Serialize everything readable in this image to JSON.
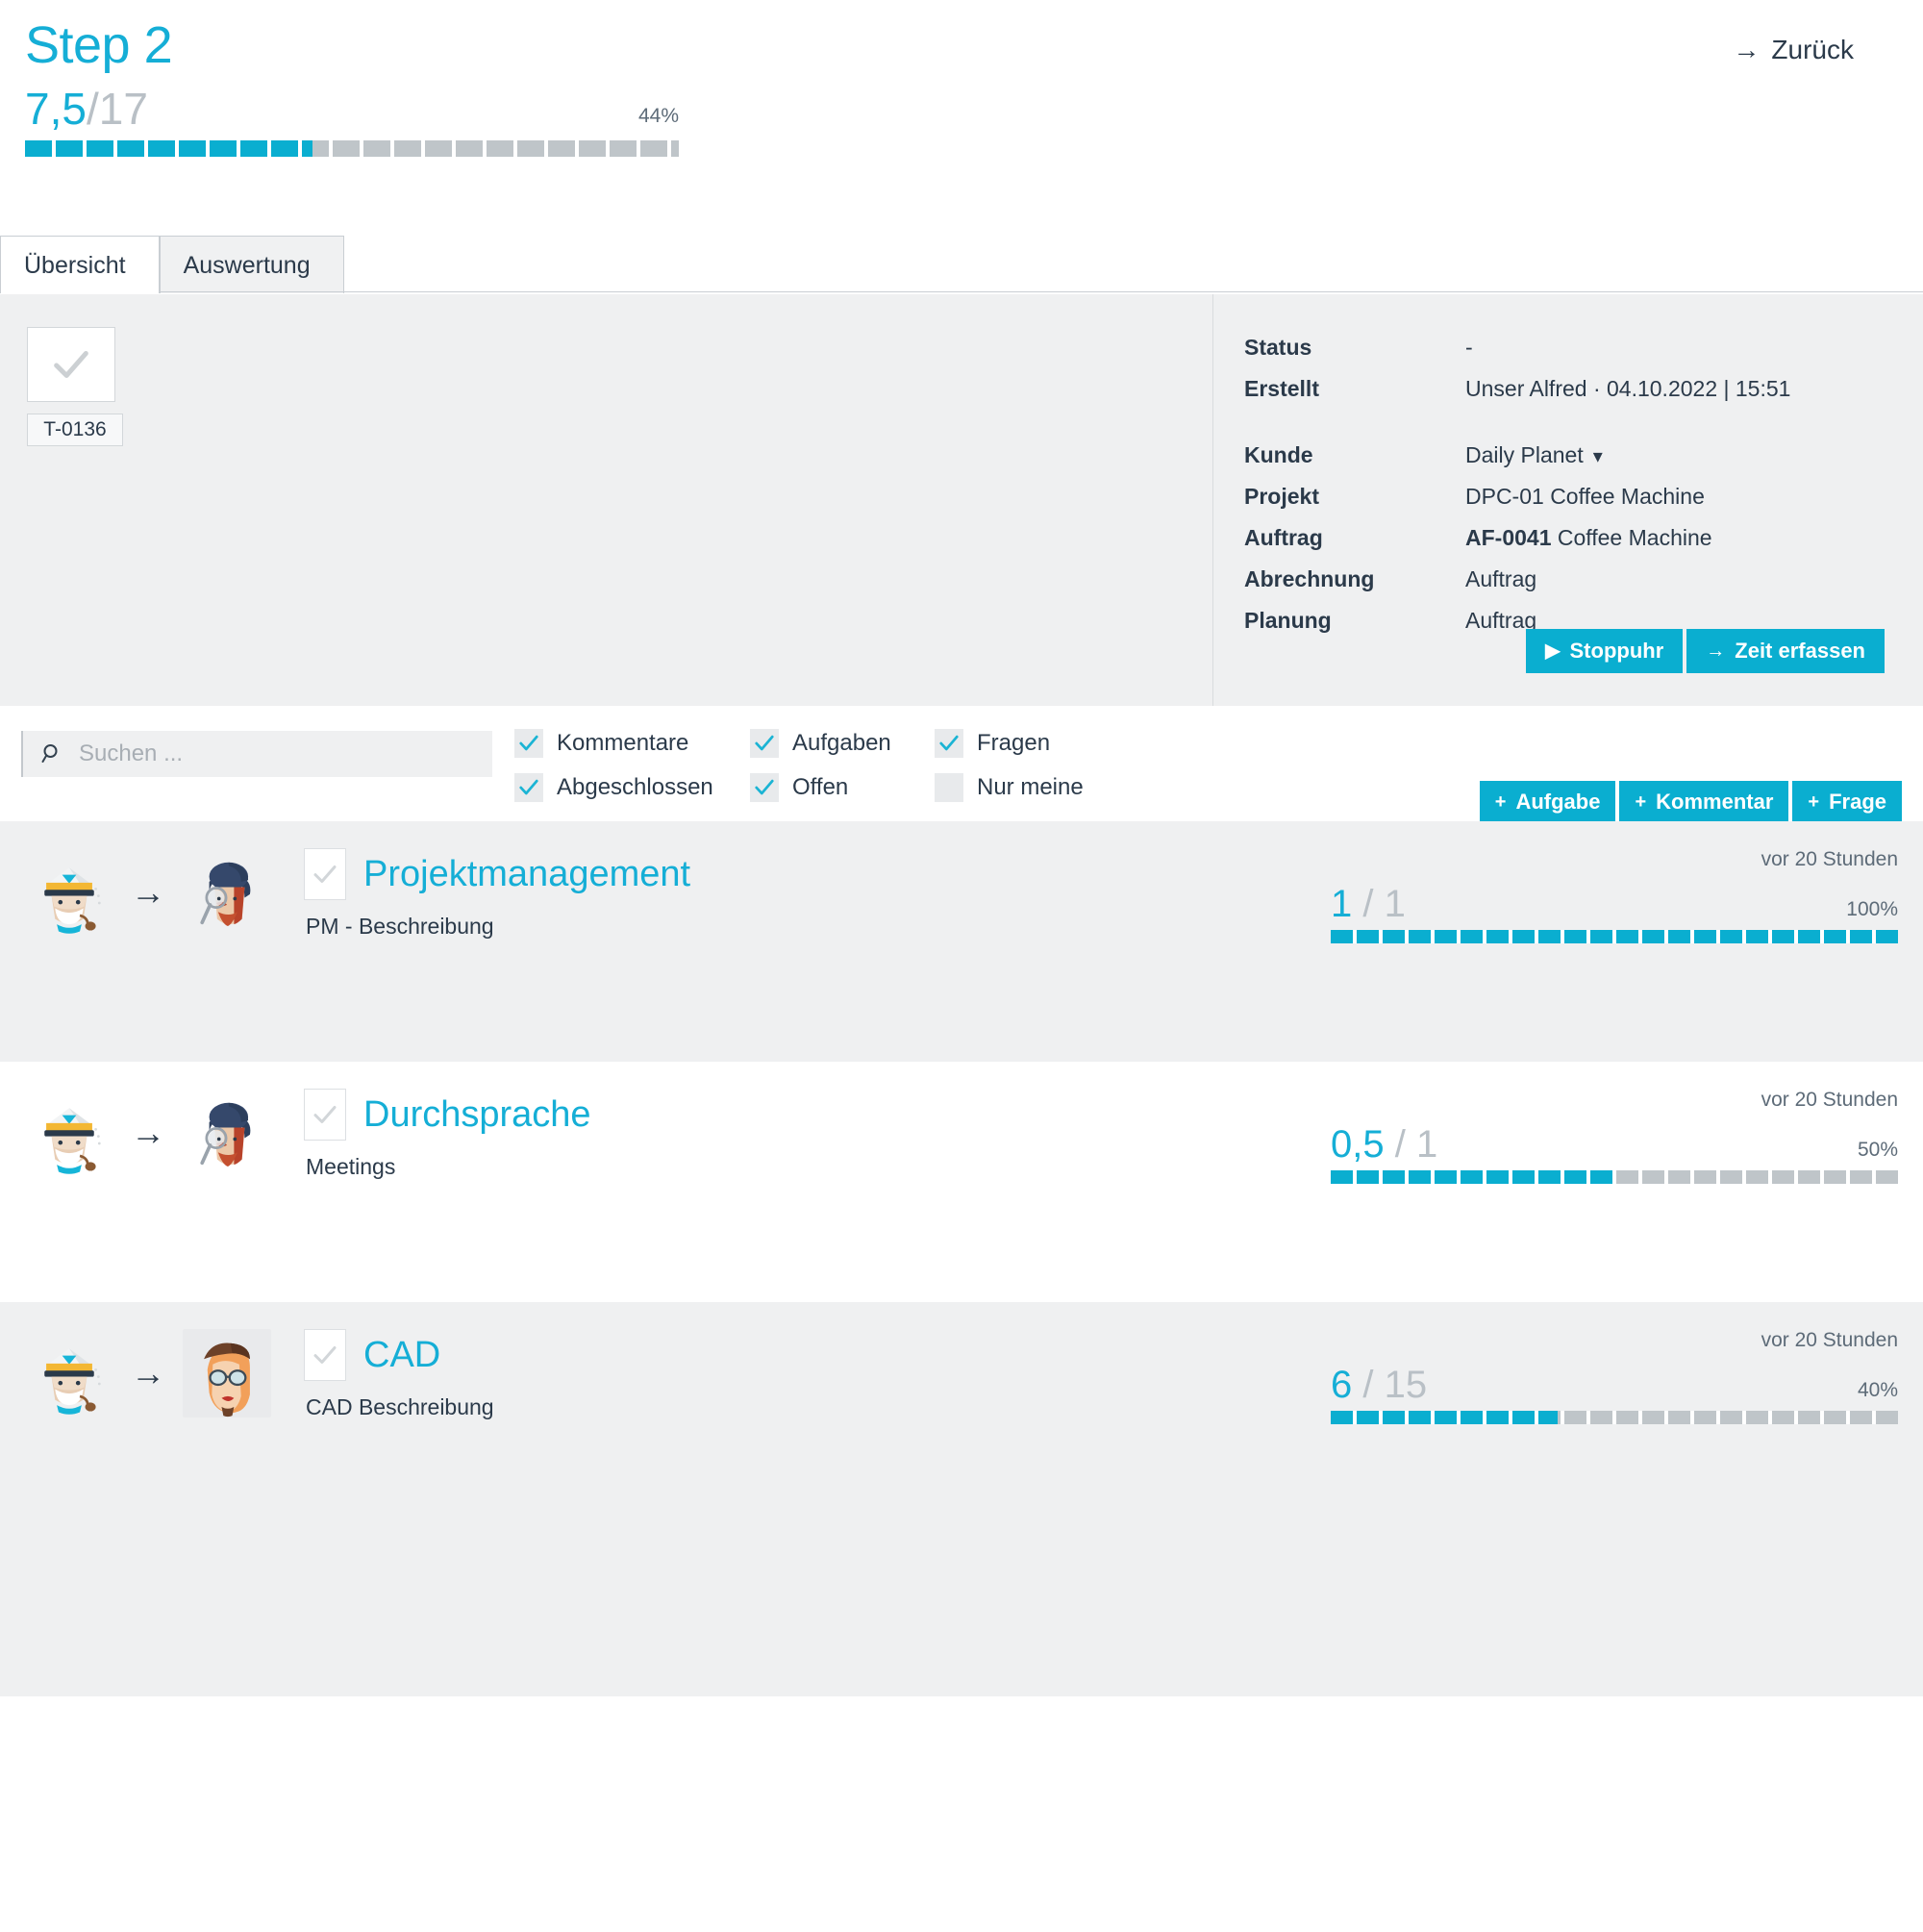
{
  "header": {
    "step_title": "Step 2",
    "back_label": "Zurück",
    "back_icon": "arrow-right-icon",
    "progress": {
      "current": "7,5",
      "separator": "/",
      "total": "17",
      "percent_label": "44%",
      "percent_value": 44
    }
  },
  "tabs": [
    {
      "label": "Übersicht",
      "active": true
    },
    {
      "label": "Auswertung",
      "active": false
    }
  ],
  "detail": {
    "task_badge": "T-0136",
    "check_icon": "check-icon",
    "meta": [
      {
        "label": "Status",
        "value": "-"
      },
      {
        "label": "Erstellt",
        "value": "Unser Alfred · 04.10.2022 | 15:51"
      },
      {
        "label": "Kunde",
        "value": "Daily Planet",
        "dropdown": true
      },
      {
        "label": "Projekt",
        "value": "DPC-01 Coffee Machine"
      },
      {
        "label": "Auftrag",
        "value_bold": "AF-0041",
        "value": "Coffee Machine"
      },
      {
        "label": "Abrechnung",
        "value": "Auftrag"
      },
      {
        "label": "Planung",
        "value": "Auftrag"
      }
    ],
    "actions": [
      {
        "label": "Stoppuhr",
        "icon": "play-icon",
        "glyph": "▶"
      },
      {
        "label": "Zeit erfassen",
        "icon": "arrow-right-icon",
        "glyph": "→"
      }
    ]
  },
  "filters": {
    "search_placeholder": "Suchen ...",
    "search_value": "",
    "search_icon": "search-icon",
    "checkboxes": [
      {
        "label": "Kommentare",
        "checked": true
      },
      {
        "label": "Aufgaben",
        "checked": true
      },
      {
        "label": "Fragen",
        "checked": true
      },
      {
        "label": "Abgeschlossen",
        "checked": true
      },
      {
        "label": "Offen",
        "checked": true
      },
      {
        "label": "Nur meine",
        "checked": false
      }
    ],
    "add_buttons": [
      {
        "label": "Aufgabe",
        "icon": "plus-icon",
        "glyph": "+"
      },
      {
        "label": "Kommentar",
        "icon": "plus-icon",
        "glyph": "+"
      },
      {
        "label": "Frage",
        "icon": "plus-icon",
        "glyph": "+"
      }
    ]
  },
  "task_rows": [
    {
      "title": "Projektmanagement",
      "description": "PM - Beschreibung",
      "time": "vor 20 Stunden",
      "current": "1",
      "separator": "/",
      "total": "1",
      "percent_label": "100%",
      "percent_value": 100,
      "from_avatar": "captain-avatar",
      "to_avatar": "detective-avatar",
      "check_icon": "check-icon"
    },
    {
      "title": "Durchsprache",
      "description": "Meetings",
      "time": "vor 20 Stunden",
      "current": "0,5",
      "separator": "/",
      "total": "1",
      "percent_label": "50%",
      "percent_value": 50,
      "from_avatar": "captain-avatar",
      "to_avatar": "detective-avatar",
      "check_icon": "check-icon"
    },
    {
      "title": "CAD",
      "description": "CAD Beschreibung",
      "time": "vor 20 Stunden",
      "current": "6",
      "separator": "/",
      "total": "15",
      "percent_label": "40%",
      "percent_value": 40,
      "from_avatar": "captain-avatar",
      "to_avatar": "designer-avatar",
      "check_icon": "check-icon"
    }
  ],
  "colors": {
    "accent": "#0aaed0",
    "accent_text": "#15aed6",
    "panel_bg": "#eff0f1",
    "text": "#2b3a4a",
    "muted": "#5d6b78",
    "bar_empty": "#bfc5c9"
  }
}
